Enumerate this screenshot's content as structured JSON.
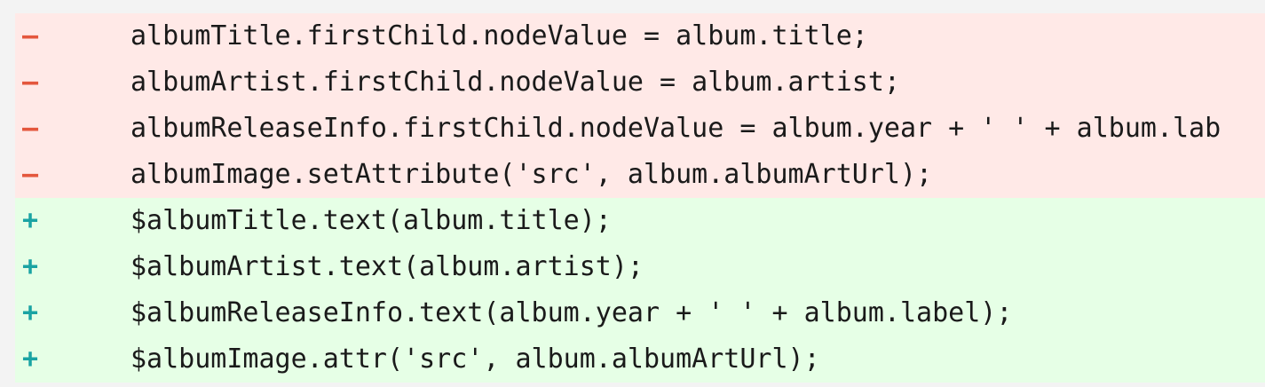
{
  "diff": {
    "lines": [
      {
        "type": "del",
        "marker": "–",
        "code": "albumTitle.firstChild.nodeValue = album.title;"
      },
      {
        "type": "del",
        "marker": "–",
        "code": "albumArtist.firstChild.nodeValue = album.artist;"
      },
      {
        "type": "del",
        "marker": "–",
        "code": "albumReleaseInfo.firstChild.nodeValue = album.year + ' ' + album.lab"
      },
      {
        "type": "del",
        "marker": "–",
        "code": "albumImage.setAttribute('src', album.albumArtUrl);"
      },
      {
        "type": "add",
        "marker": "+",
        "code": "$albumTitle.text(album.title);"
      },
      {
        "type": "add",
        "marker": "+",
        "code": "$albumArtist.text(album.artist);"
      },
      {
        "type": "add",
        "marker": "+",
        "code": "$albumReleaseInfo.text(album.year + ' ' + album.label);"
      },
      {
        "type": "add",
        "marker": "+",
        "code": "$albumImage.attr('src', album.albumArtUrl);"
      }
    ],
    "colors": {
      "deleted_bg": "#ffe9e7",
      "added_bg": "#e6ffe6",
      "deleted_marker": "#e4573d",
      "added_marker": "#1aa3a3"
    }
  }
}
